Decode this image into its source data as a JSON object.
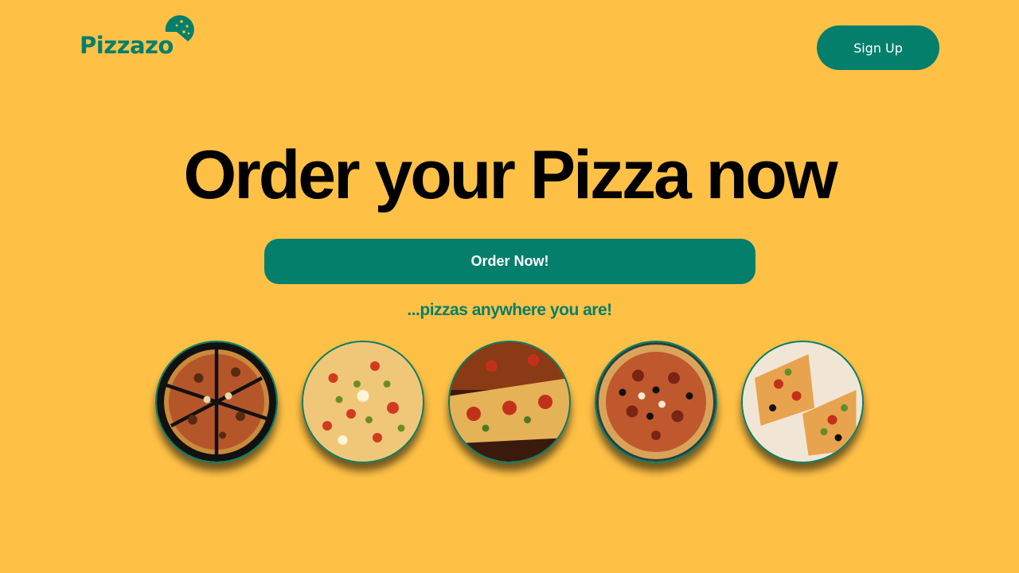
{
  "header": {
    "logo_text": "Pizzazo",
    "signup_label": "Sign Up"
  },
  "hero": {
    "title": "Order your Pizza now",
    "order_button_label": "Order Now!",
    "tagline": "...pizzas anywhere you are!"
  },
  "gallery": {
    "items": [
      {
        "name": "pizza-image-1",
        "icon": "pizza-sliced-dark"
      },
      {
        "name": "pizza-image-2",
        "icon": "pizza-veggie"
      },
      {
        "name": "pizza-image-3",
        "icon": "pizza-slice-closeup"
      },
      {
        "name": "pizza-image-4",
        "icon": "pizza-pepperoni-olive"
      },
      {
        "name": "pizza-image-5",
        "icon": "pizza-slices-board"
      }
    ]
  },
  "colors": {
    "background": "#FFC145",
    "brand_green": "#037F6C",
    "text_dark": "#000000",
    "button_text": "#FFFFFF"
  }
}
